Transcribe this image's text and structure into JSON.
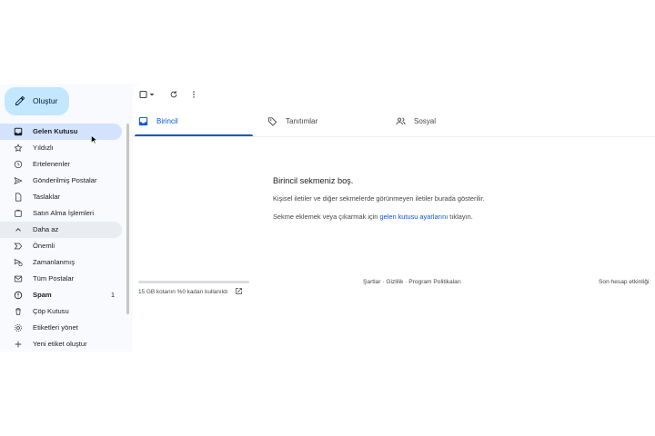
{
  "compose": {
    "label": "Oluştur",
    "icon": "pencil-icon"
  },
  "sidebar": {
    "items": [
      {
        "label": "Gelen Kutusu",
        "icon": "inbox-icon",
        "active": true
      },
      {
        "label": "Yıldızlı",
        "icon": "star-icon"
      },
      {
        "label": "Ertelenenler",
        "icon": "clock-icon"
      },
      {
        "label": "Gönderilmiş Postalar",
        "icon": "send-icon"
      },
      {
        "label": "Taslaklar",
        "icon": "draft-icon"
      },
      {
        "label": "Satın Alma İşlemleri",
        "icon": "purchase-icon"
      },
      {
        "label": "Daha az",
        "icon": "chevron-up-icon"
      },
      {
        "label": "Önemli",
        "icon": "important-icon"
      },
      {
        "label": "Zamanlanmış",
        "icon": "scheduled-icon"
      },
      {
        "label": "Tüm Postalar",
        "icon": "all-mail-icon"
      },
      {
        "label": "Spam",
        "icon": "spam-icon",
        "count": "1"
      },
      {
        "label": "Çöp Kutusu",
        "icon": "trash-icon"
      },
      {
        "label": "Etiketleri yönet",
        "icon": "gear-icon"
      },
      {
        "label": "Yeni etiket oluştur",
        "icon": "plus-icon"
      }
    ]
  },
  "tabs": [
    {
      "label": "Birincil",
      "icon": "inbox-icon",
      "active": true
    },
    {
      "label": "Tanıtımlar",
      "icon": "tag-icon"
    },
    {
      "label": "Sosyal",
      "icon": "people-icon"
    }
  ],
  "empty_state": {
    "title": "Birincil sekmeniz boş.",
    "line1": "Kişisel iletiler ve diğer sekmelerde görünmeyen iletiler burada gösterilir.",
    "line2_prefix": "Sekme eklemek veya çıkarmak için ",
    "line2_link": "gelen kutusu ayarlarını",
    "line2_suffix": " tıklayın."
  },
  "footer": {
    "storage": "15 GB kotanın %0 kadarı kullanıldı",
    "terms": "Şartlar",
    "privacy": "Gizlilik",
    "program": "Program Politikaları",
    "separator": "·",
    "last_activity": "Son hesap etkinliği:"
  },
  "colors": {
    "accent": "#0b57d0",
    "compose_bg": "#c2e7ff",
    "active_item_bg": "#d3e3fd"
  }
}
